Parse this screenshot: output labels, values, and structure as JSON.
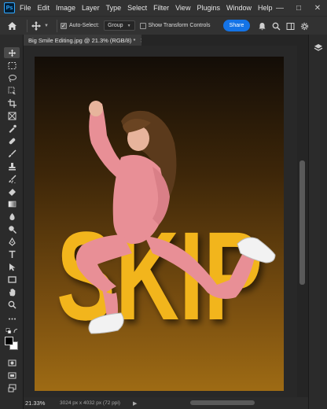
{
  "app": {
    "logo_text": "Ps"
  },
  "menu": {
    "items": [
      "File",
      "Edit",
      "Image",
      "Layer",
      "Type",
      "Select",
      "Filter",
      "View",
      "Plugins",
      "Window",
      "Help"
    ]
  },
  "options_bar": {
    "auto_select_label": "Auto-Select:",
    "auto_select_checked": true,
    "target_value": "Group",
    "transform_controls_label": "Show Transform Controls",
    "transform_controls_checked": false,
    "share_label": "Share"
  },
  "document": {
    "tab_title": "Big Smile Editing.jpg @ 21.3% (RGB/8) *",
    "artwork_text": "SKIP"
  },
  "status": {
    "zoom": "21.33%",
    "doc_info": "3024 px x 4032 px (72 ppi)"
  },
  "colors": {
    "accent": "#1473e6",
    "lettering": "#f2b51f",
    "suit": "#e88f96"
  }
}
